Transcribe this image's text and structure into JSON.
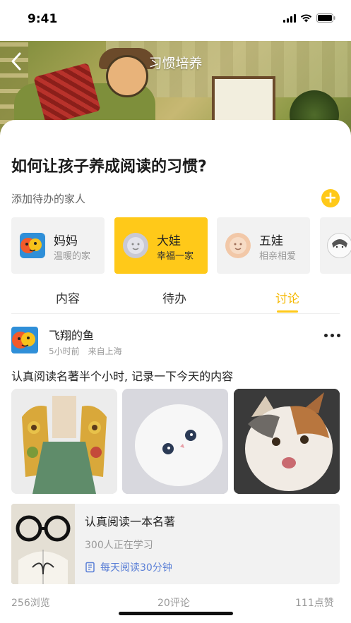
{
  "status_bar": {
    "time": "9:41"
  },
  "header": {
    "title": "习惯培养"
  },
  "headline": "如何让孩子养成阅读的习惯?",
  "add_family": {
    "label": "添加待办的家人",
    "button": "+"
  },
  "members": [
    {
      "name": "妈妈",
      "sub": "温暖的家",
      "active": false
    },
    {
      "name": "大娃",
      "sub": "幸福一家",
      "active": true
    },
    {
      "name": "五娃",
      "sub": "相亲相爱",
      "active": false
    }
  ],
  "tabs": [
    {
      "label": "内容",
      "active": false
    },
    {
      "label": "待办",
      "active": false
    },
    {
      "label": "讨论",
      "active": true
    }
  ],
  "post": {
    "author": "飞翔的鱼",
    "time": "5小时前",
    "location": "来自上海",
    "text": "认真阅读名著半个小时, 记录一下今天的内容"
  },
  "course": {
    "title": "认真阅读一本名著",
    "count": "300人正在学习",
    "tag": "每天阅读30分钟"
  },
  "stats": {
    "views": "256浏览",
    "comments": "20评论",
    "likes": "111点赞"
  },
  "colors": {
    "accent": "#ffc919",
    "link": "#5a7fd6"
  }
}
